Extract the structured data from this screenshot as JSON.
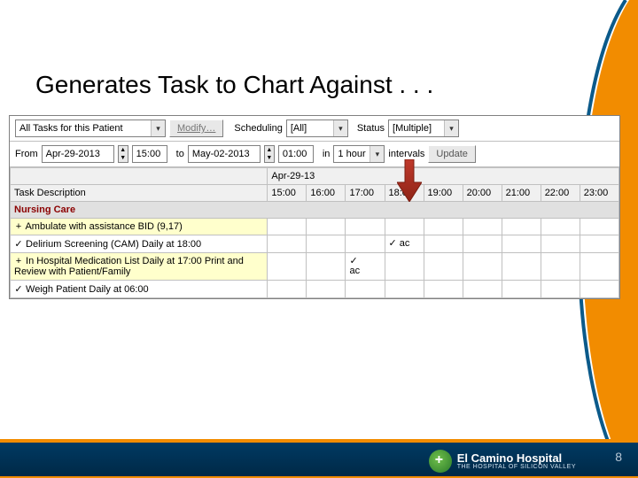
{
  "slide": {
    "title": "Generates Task to Chart Against . . .",
    "page_number": "8",
    "logo_line1": "El Camino Hospital",
    "logo_tagline": "THE HOSPITAL OF SILICON VALLEY"
  },
  "toolbar1": {
    "filter_combo": "All Tasks for this Patient",
    "modify_button": "Modify…",
    "scheduling_label": "Scheduling",
    "scheduling_value": "[All]",
    "status_label": "Status",
    "status_value": "[Multiple]"
  },
  "toolbar2": {
    "from_label": "From",
    "from_date": "Apr-29-2013",
    "from_time": "15:00",
    "to_label": "to",
    "to_date": "May-02-2013",
    "to_time": "01:00",
    "in_label": "in",
    "interval_value": "1 hour",
    "intervals_label": "intervals",
    "update_button": "Update"
  },
  "grid": {
    "date_header": "Apr-29-13",
    "col_desc": "Task Description",
    "times": [
      "15:00",
      "16:00",
      "17:00",
      "18:00",
      "19:00",
      "20:00",
      "21:00",
      "22:00",
      "23:00"
    ],
    "section": "Nursing Care",
    "rows": [
      {
        "mark": "+",
        "desc": "Ambulate with assistance BID (9,17)",
        "highlight": true,
        "cells": [
          "",
          "",
          "",
          "",
          "",
          "",
          "",
          "",
          ""
        ]
      },
      {
        "mark": "✓",
        "desc": "Delirium Screening (CAM) Daily at 18:00",
        "highlight": false,
        "cells": [
          "",
          "",
          "",
          "✓ ac",
          "",
          "",
          "",
          "",
          ""
        ]
      },
      {
        "mark": "+",
        "desc": "In Hospital Medication List Daily at 17:00 Print and Review with Patient/Family",
        "highlight": true,
        "cells": [
          "",
          "",
          "✓\nac",
          "",
          "",
          "",
          "",
          "",
          ""
        ]
      },
      {
        "mark": "✓",
        "desc": "Weigh Patient Daily at 06:00",
        "highlight": false,
        "cells": [
          "",
          "",
          "",
          "",
          "",
          "",
          "",
          "",
          ""
        ]
      }
    ]
  }
}
